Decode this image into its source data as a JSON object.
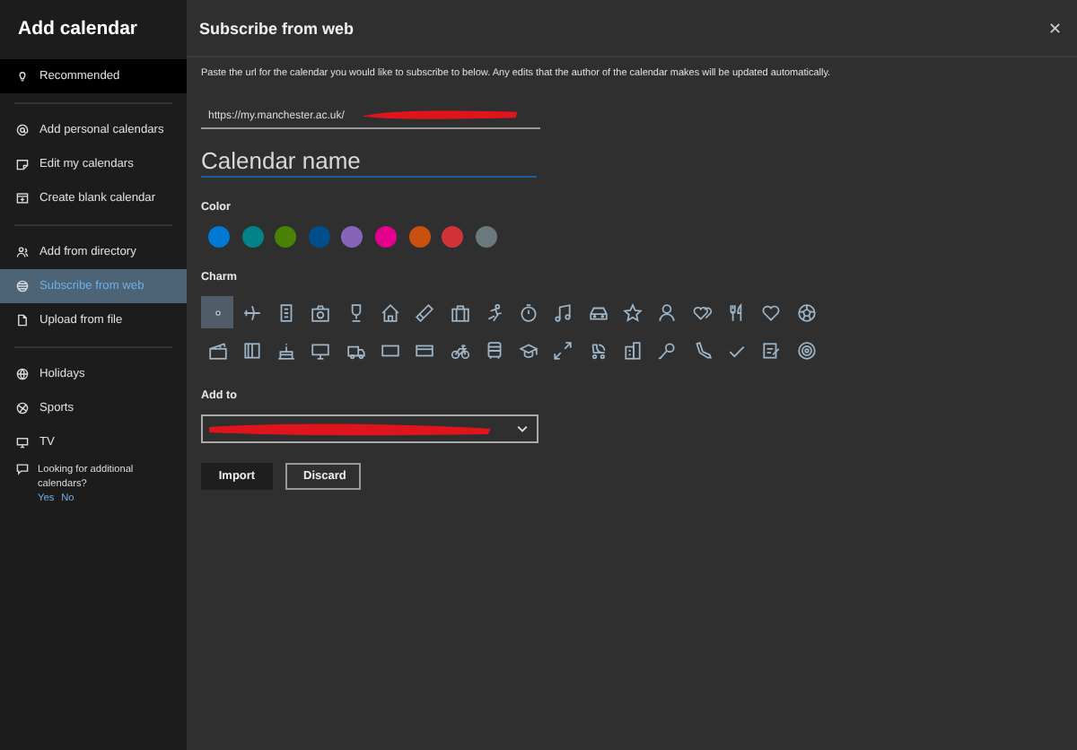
{
  "sidebar": {
    "title": "Add calendar",
    "groups": [
      [
        {
          "label": "Recommended",
          "selected": false,
          "highlighted": true
        }
      ],
      [
        {
          "label": "Add personal calendars",
          "selected": false,
          "highlighted": false
        },
        {
          "label": "Edit my calendars",
          "selected": false,
          "highlighted": false
        },
        {
          "label": "Create blank calendar",
          "selected": false,
          "highlighted": false
        }
      ],
      [
        {
          "label": "Add from directory",
          "selected": false,
          "highlighted": false
        },
        {
          "label": "Subscribe from web",
          "selected": true,
          "highlighted": false
        },
        {
          "label": "Upload from file",
          "selected": false,
          "highlighted": false
        }
      ],
      [
        {
          "label": "Holidays",
          "selected": false,
          "highlighted": false
        },
        {
          "label": "Sports",
          "selected": false,
          "highlighted": false
        },
        {
          "label": "TV",
          "selected": false,
          "highlighted": false
        }
      ]
    ],
    "feedback": {
      "text": "Looking for additional calendars?",
      "yes": "Yes",
      "no": "No"
    }
  },
  "panel": {
    "title": "Subscribe from web",
    "close": "✕",
    "description": "Paste the url for the calendar you would like to subscribe to below. Any edits that the author of the calendar makes will be updated automatically.",
    "url_field": {
      "value": "https://my.manchester.ac.uk/"
    },
    "name_field": {
      "placeholder": "Calendar name"
    },
    "color_label": "Color",
    "colors": [
      {
        "color": "#0078d4"
      },
      {
        "color": "#038387"
      },
      {
        "color": "#498205"
      },
      {
        "color": "#004e8c"
      },
      {
        "color": "#8764b8"
      },
      {
        "color": "#e3008c"
      },
      {
        "color": "#ca5010"
      },
      {
        "color": "#d13438"
      },
      {
        "color": "#69797e"
      }
    ],
    "charm_label": "Charm",
    "charms": [
      {
        "selected": true
      },
      {
        "selected": false
      },
      {
        "selected": false
      },
      {
        "selected": false
      },
      {
        "selected": false
      },
      {
        "selected": false
      },
      {
        "selected": false
      },
      {
        "selected": false
      },
      {
        "selected": false
      },
      {
        "selected": false
      },
      {
        "selected": false
      },
      {
        "selected": false
      },
      {
        "selected": false
      },
      {
        "selected": false
      },
      {
        "selected": false
      },
      {
        "selected": false
      },
      {
        "selected": false
      },
      {
        "selected": false
      },
      {
        "selected": false
      },
      {
        "selected": false
      },
      {
        "selected": false
      },
      {
        "selected": false
      },
      {
        "selected": false
      },
      {
        "selected": false
      },
      {
        "selected": false
      },
      {
        "selected": false
      },
      {
        "selected": false
      },
      {
        "selected": false
      },
      {
        "selected": false
      },
      {
        "selected": false
      },
      {
        "selected": false
      },
      {
        "selected": false
      },
      {
        "selected": false
      },
      {
        "selected": false
      },
      {
        "selected": false
      },
      {
        "selected": false
      }
    ],
    "add_to_label": "Add to",
    "buttons": [
      "Import",
      "Discard"
    ]
  }
}
